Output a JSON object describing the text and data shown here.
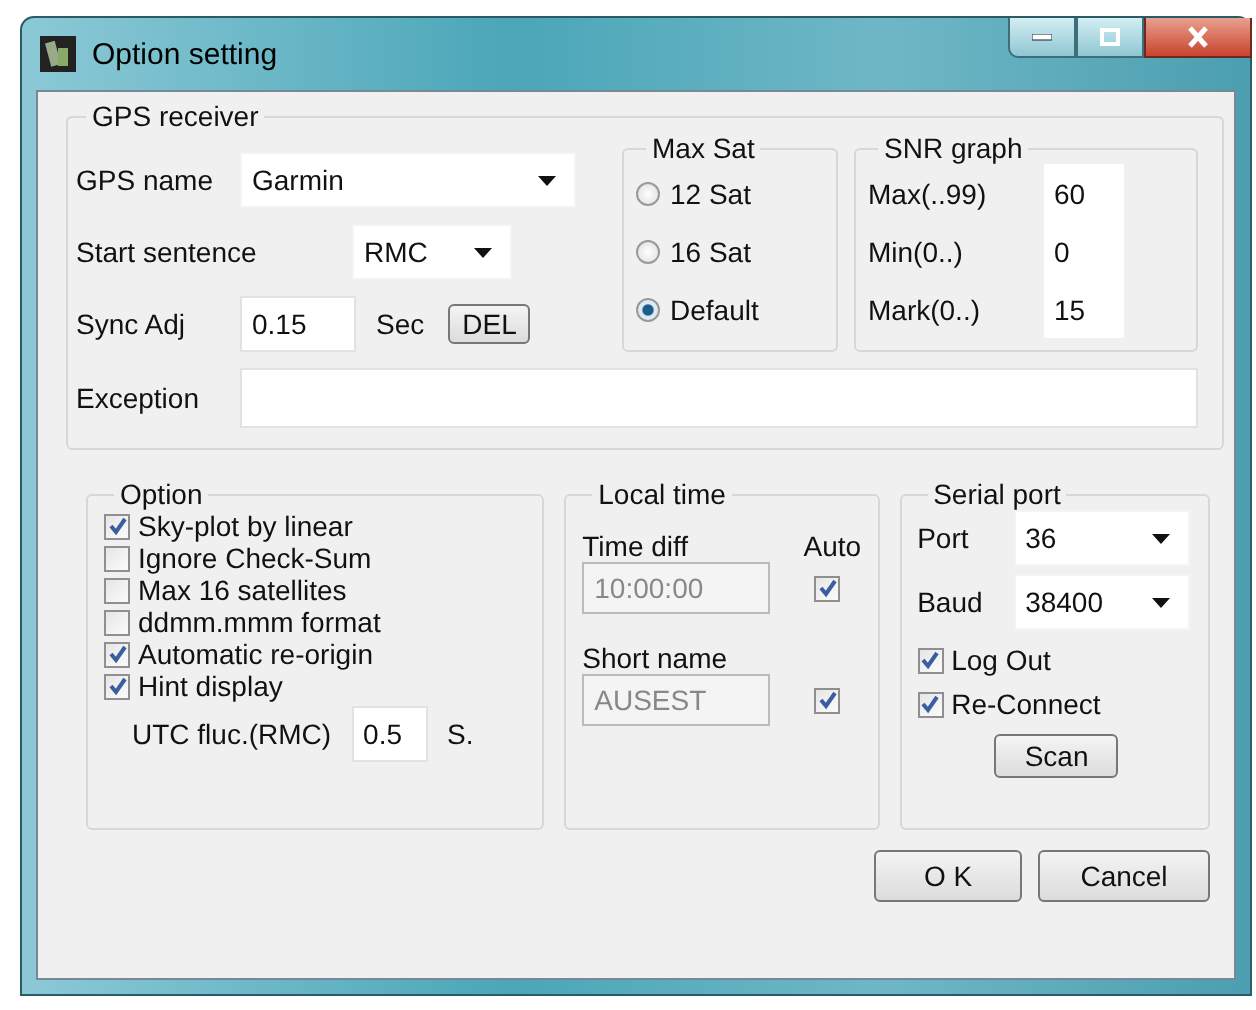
{
  "window": {
    "title": "Option setting"
  },
  "gps_receiver": {
    "title": "GPS receiver",
    "gps_name": {
      "label": "GPS name",
      "value": "Garmin"
    },
    "start_sentence": {
      "label": "Start sentence",
      "value": "RMC"
    },
    "sync_adj": {
      "label": "Sync Adj",
      "value": "0.15",
      "unit": "Sec",
      "button": "DEL"
    },
    "exception": {
      "label": "Exception"
    },
    "max_sat": {
      "title": "Max Sat",
      "options": [
        {
          "label": "12 Sat",
          "selected": false
        },
        {
          "label": "16 Sat",
          "selected": false
        },
        {
          "label": "Default",
          "selected": true
        }
      ]
    },
    "snr_graph": {
      "title": "SNR graph",
      "fields": [
        {
          "label": "Max(..99)",
          "value": "60"
        },
        {
          "label": "Min(0..)",
          "value": "0"
        },
        {
          "label": "Mark(0..)",
          "value": "15"
        }
      ]
    }
  },
  "option": {
    "title": "Option",
    "checkboxes": [
      {
        "label": "Sky-plot by linear",
        "checked": true
      },
      {
        "label": "Ignore Check-Sum",
        "checked": false
      },
      {
        "label": "Max 16 satellites",
        "checked": false
      },
      {
        "label": "ddmm.mmm format",
        "checked": false
      },
      {
        "label": "Automatic re-origin",
        "checked": true
      },
      {
        "label": "Hint display",
        "checked": true
      }
    ],
    "utc_fluc": {
      "label": "UTC fluc.(RMC)",
      "value": "0.5",
      "unit": "S."
    }
  },
  "local_time": {
    "title": "Local time",
    "time_diff": {
      "label": "Time diff",
      "value": "10:00:00",
      "disabled": true
    },
    "auto": {
      "label": "Auto",
      "checked": true
    },
    "short_name": {
      "label": "Short name",
      "value": "AUSEST",
      "disabled": true,
      "checked": true
    }
  },
  "serial_port": {
    "title": "Serial port",
    "port": {
      "label": "Port",
      "value": "36"
    },
    "baud": {
      "label": "Baud",
      "value": "38400"
    },
    "checkboxes": [
      {
        "label": "Log Out",
        "checked": true
      },
      {
        "label": "Re-Connect",
        "checked": true
      }
    ],
    "scan_button": "Scan"
  },
  "buttons": [
    "O K",
    "Cancel"
  ]
}
